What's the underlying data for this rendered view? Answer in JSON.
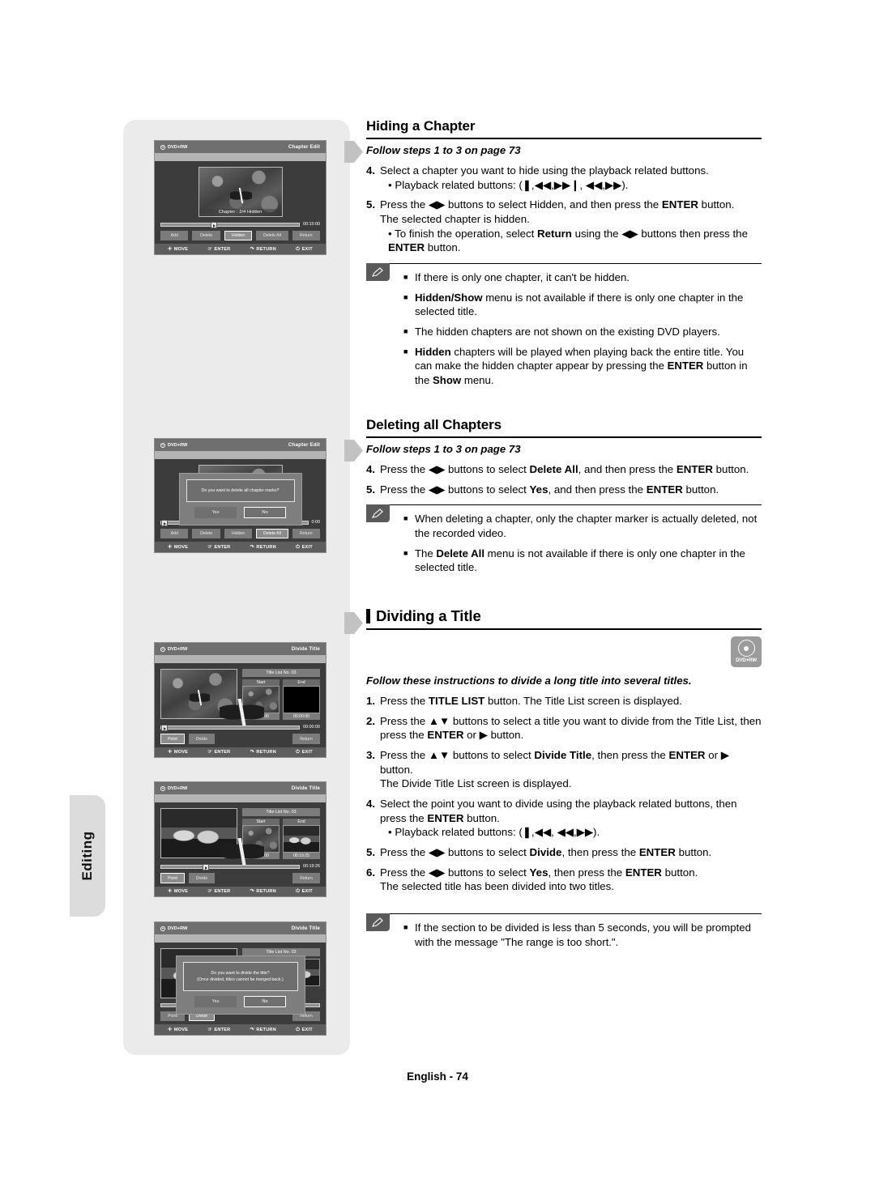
{
  "page": {
    "footer": "English - 74",
    "side_tab": "Editing"
  },
  "sections": {
    "hiding": {
      "heading": "Hiding a Chapter",
      "follow": "Follow steps 1 to 3 on page 73",
      "steps": [
        {
          "num": "4.",
          "text": "Select a chapter you want to hide using the playback related buttons.",
          "sub": "• Playback related buttons: (❚,◀◀,▶▶❙, ◀◀,▶▶)."
        },
        {
          "num": "5.",
          "text": "Press the ◀▶ buttons to select Hidden, and then press the ENTER button.",
          "cont": "The selected chapter is hidden.",
          "sub": "• To finish the operation, select Return using the ◀▶ buttons then press the ENTER button."
        }
      ],
      "notes": [
        "If there is only one chapter, it can't be hidden.",
        "Hidden/Show menu is not available if there is only one chapter in the selected title.",
        "The hidden chapters are not shown on the existing DVD players.",
        "Hidden chapters will be played when playing back the entire title. You can make the hidden chapter appear by pressing the ENTER button in the Show menu."
      ]
    },
    "deleting": {
      "heading": "Deleting all Chapters",
      "follow": "Follow steps 1 to 3 on page 73",
      "steps": [
        {
          "num": "4.",
          "text": "Press the ◀▶ buttons to select Delete All, and then press the ENTER button."
        },
        {
          "num": "5.",
          "text": "Press the ◀▶ buttons to select Yes, and then press the ENTER button."
        }
      ],
      "notes": [
        "When deleting a chapter, only the chapter marker is actually deleted, not the recorded video.",
        "The Delete All menu is not available if there is only one chapter in the selected title."
      ]
    },
    "dividing": {
      "heading": "Dividing a Title",
      "badge_label": "DVD+RW",
      "follow": "Follow these instructions to divide a long title into several titles.",
      "steps": [
        {
          "num": "1.",
          "text": "Press the TITLE LIST button. The Title List screen is displayed."
        },
        {
          "num": "2.",
          "text": "Press the ▲▼ buttons to select a title you want to divide from the Title List, then press the ENTER or ▶ button."
        },
        {
          "num": "3.",
          "text": "Press the ▲▼ buttons to select Divide Title, then press the ENTER or ▶ button.",
          "cont": "The Divide Title List screen is displayed."
        },
        {
          "num": "4.",
          "text": "Select the point you want to divide using the playback related buttons, then press the ENTER button.",
          "sub": "• Playback related buttons: (❚,◀◀, ◀◀,▶▶)."
        },
        {
          "num": "5.",
          "text": "Press the ◀▶ buttons to select Divide, then press the ENTER button."
        },
        {
          "num": "6.",
          "text": "Press the ◀▶ buttons to select Yes, then press the ENTER button.",
          "cont": "The selected title has been divided into two titles."
        }
      ],
      "notes": [
        "If the section to be divided is less than 5 seconds, you will be prompted with the message \"The range is too short.\"."
      ]
    }
  },
  "osd_common": {
    "disc_label": "DVD+RW",
    "footer": {
      "move": "MOVE",
      "enter": "ENTER",
      "return": "RETURN",
      "exit": "EXIT"
    }
  },
  "osd_screens": {
    "chapter_edit_hidden": {
      "screen_name": "Chapter Edit",
      "chapter_label": "Chapter : 2/4 Hidden",
      "time": "00:15:00",
      "buttons": [
        "Add",
        "Delete",
        "Hidden",
        "Delete All",
        "Return"
      ],
      "selected_button": "Hidden"
    },
    "chapter_edit_delete_all": {
      "screen_name": "Chapter Edit",
      "time": "0:00",
      "dialog_message": "Do you want to delete all chapter marks?",
      "dialog_buttons": [
        "Yes",
        "No"
      ],
      "dialog_selected": "No",
      "buttons": [
        "Add",
        "Delete",
        "Hidden",
        "Delete All",
        "Return"
      ],
      "selected_button": "Delete All"
    },
    "divide_title_start": {
      "screen_name": "Divide Title",
      "title_list": "Title List No. 03",
      "start_label": "Start",
      "end_label": "End",
      "start_time": "00:00:00",
      "end_time": "00:00:00",
      "time": "00:00:00",
      "buttons": [
        "Point",
        "Divide",
        "Return"
      ],
      "selected_button": "Point"
    },
    "divide_title_point": {
      "screen_name": "Divide Title",
      "title_list": "Title List No. 03",
      "start_label": "Start",
      "end_label": "End",
      "start_time": "00:00:00",
      "end_time": "00:19:25",
      "time": "00:19:25",
      "buttons": [
        "Point",
        "Divide",
        "Return"
      ],
      "selected_button": "Point"
    },
    "divide_title_confirm": {
      "screen_name": "Divide Title",
      "title_list": "Title List No. 03",
      "dialog_message_line1": "Do you want to divide the title?",
      "dialog_message_line2": "(Once divided, titles cannot be merged back.)",
      "dialog_buttons": [
        "Yes",
        "No"
      ],
      "dialog_selected": "No",
      "buttons": [
        "Point",
        "Divide",
        "Return"
      ],
      "selected_button": "Divide"
    }
  }
}
